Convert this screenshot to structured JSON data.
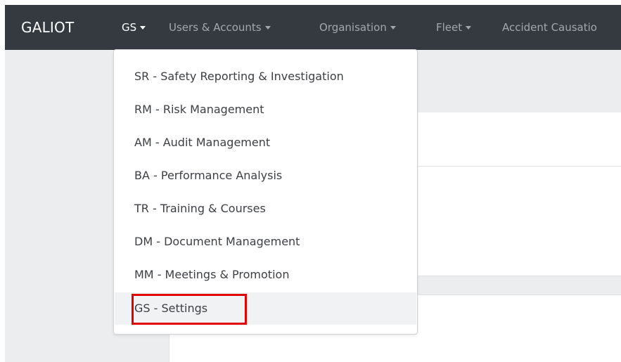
{
  "navbar": {
    "brand": "GALIOT",
    "items": [
      {
        "label": "GS"
      },
      {
        "label": "Users & Accounts"
      },
      {
        "label": "Organisation"
      },
      {
        "label": "Fleet"
      },
      {
        "label": "Accident Causatio"
      }
    ]
  },
  "dropdown": {
    "items": [
      {
        "label": "SR - Safety Reporting & Investigation"
      },
      {
        "label": "RM - Risk Management"
      },
      {
        "label": "AM - Audit Management"
      },
      {
        "label": "BA - Performance Analysis"
      },
      {
        "label": "TR - Training & Courses"
      },
      {
        "label": "DM - Document Management"
      },
      {
        "label": "MM - Meetings & Promotion"
      },
      {
        "label": "GS - Settings"
      }
    ]
  },
  "colors": {
    "navbar_bg": "#343a40",
    "highlight": "#e00000",
    "page_bg": "#ebedef"
  }
}
